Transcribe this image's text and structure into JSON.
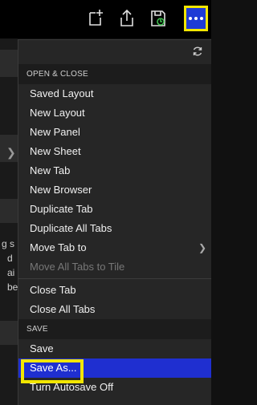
{
  "background": {
    "fragments": [
      "g s",
      "d",
      "ai",
      "be"
    ]
  },
  "toolbar": {
    "icons": [
      "new-window-icon",
      "share-icon",
      "save-icon",
      "more-icon"
    ]
  },
  "menu": {
    "open_close": {
      "header": "OPEN & CLOSE",
      "items": [
        {
          "label": "Saved Layout"
        },
        {
          "label": "New Layout"
        },
        {
          "label": "New Panel"
        },
        {
          "label": "New Sheet"
        },
        {
          "label": "New Tab"
        },
        {
          "label": "New Browser"
        },
        {
          "label": "Duplicate Tab"
        },
        {
          "label": "Duplicate All Tabs"
        },
        {
          "label": "Move Tab to"
        },
        {
          "label": "Move All Tabs to Tile"
        },
        {
          "label": "Close Tab"
        },
        {
          "label": "Close All Tabs"
        }
      ]
    },
    "save": {
      "header": "SAVE",
      "items": [
        {
          "label": "Save"
        },
        {
          "label": "Save As..."
        },
        {
          "label": "Turn Autosave Off"
        }
      ]
    }
  },
  "colors": {
    "accent": "#1f2fd0",
    "highlight_box": "#f2e600",
    "menu_bg": "#262626"
  }
}
